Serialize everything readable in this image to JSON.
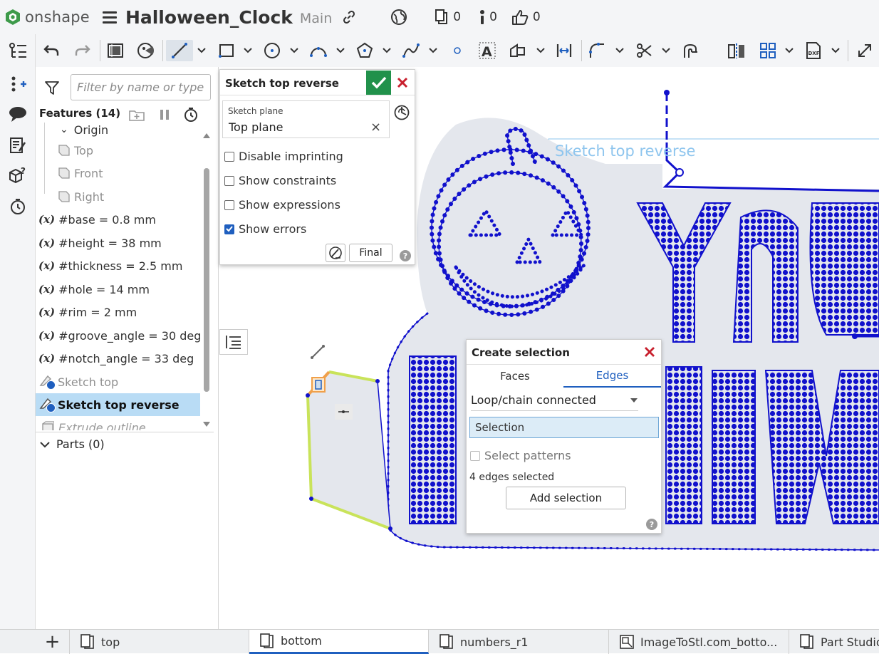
{
  "app": {
    "logo_text": "onshape",
    "doc_title": "Halloween_Clock",
    "branch": "Main",
    "counters": {
      "versions": "0",
      "info": "0",
      "likes": "0"
    }
  },
  "feature_panel": {
    "filter_placeholder": "Filter by name or type",
    "header": "Features (14)",
    "items": [
      {
        "label": "Origin",
        "kind": "origin"
      },
      {
        "label": "Top",
        "kind": "plane"
      },
      {
        "label": "Front",
        "kind": "plane"
      },
      {
        "label": "Right",
        "kind": "plane"
      },
      {
        "label": "#base = 0.8 mm",
        "kind": "variable"
      },
      {
        "label": "#height = 38 mm",
        "kind": "variable"
      },
      {
        "label": "#thickness = 2.5 mm",
        "kind": "variable"
      },
      {
        "label": "#hole = 14 mm",
        "kind": "variable"
      },
      {
        "label": "#rim = 2 mm",
        "kind": "variable"
      },
      {
        "label": "#groove_angle = 30 deg",
        "kind": "variable"
      },
      {
        "label": "#notch_angle = 33 deg",
        "kind": "variable"
      },
      {
        "label": "Sketch top",
        "kind": "sketch"
      },
      {
        "label": "Sketch top reverse",
        "kind": "sketch-selected"
      },
      {
        "label": "Extrude outline",
        "kind": "extrude"
      }
    ],
    "parts": "Parts (0)"
  },
  "sketch_dialog": {
    "title": "Sketch top reverse",
    "plane_label": "Sketch plane",
    "plane_value": "Top plane",
    "options": [
      {
        "label": "Disable imprinting",
        "checked": false
      },
      {
        "label": "Show constraints",
        "checked": false
      },
      {
        "label": "Show expressions",
        "checked": false
      },
      {
        "label": "Show errors",
        "checked": true
      }
    ],
    "final_label": "Final",
    "help": "?"
  },
  "selection_dialog": {
    "title": "Create selection",
    "tabs": [
      "Faces",
      "Edges"
    ],
    "active_tab": "Edges",
    "mode": "Loop/chain connected",
    "selection_label": "Selection",
    "patterns_label": "Select patterns",
    "count_text": "4 edges selected",
    "add_label": "Add selection",
    "help": "?"
  },
  "canvas": {
    "sketch_label": "Sketch top reverse"
  },
  "bottom_tabs": {
    "add": "+",
    "tabs": [
      "top",
      "bottom",
      "numbers_r1",
      "ImageToStl.com_botto...",
      "Part Studio"
    ],
    "active": "bottom"
  },
  "colors": {
    "sketch_blue": "#1010cc",
    "accent": "#1f5fbf",
    "ok_green": "#21914b",
    "close_red": "#c8202e",
    "selected_row": "#b9dcf5",
    "highlight_edge": "#c9e35a"
  }
}
